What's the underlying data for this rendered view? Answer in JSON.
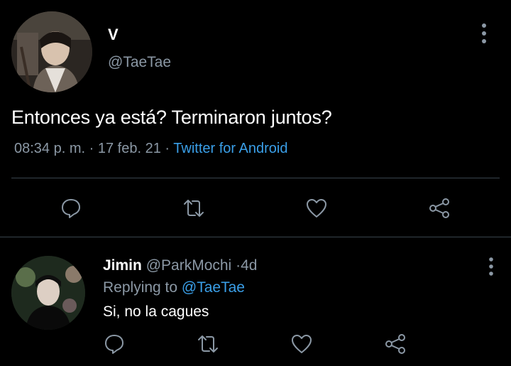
{
  "main_tweet": {
    "display_name": "V",
    "handle": "@TaeTae",
    "text": "Entonces ya está? Terminaron juntos?",
    "time": "08:34 p. m.",
    "date": "17 feb. 21",
    "separator": "·",
    "source": "Twitter for Android",
    "actions": [
      "reply-icon",
      "retweet-icon",
      "like-icon",
      "share-icon"
    ]
  },
  "reply": {
    "display_name": "Jimin",
    "handle": "@ParkMochi",
    "separator": "·",
    "time": "4d",
    "replying_label": "Replying to",
    "replying_to": "@TaeTae",
    "text": "Si, no la cagues",
    "actions": [
      "reply-icon",
      "retweet-icon",
      "like-icon",
      "share-icon"
    ]
  },
  "colors": {
    "background": "#000000",
    "text": "#ffffff",
    "secondary": "#8b98a5",
    "link": "#3a9fe8",
    "divider": "#38444d"
  }
}
